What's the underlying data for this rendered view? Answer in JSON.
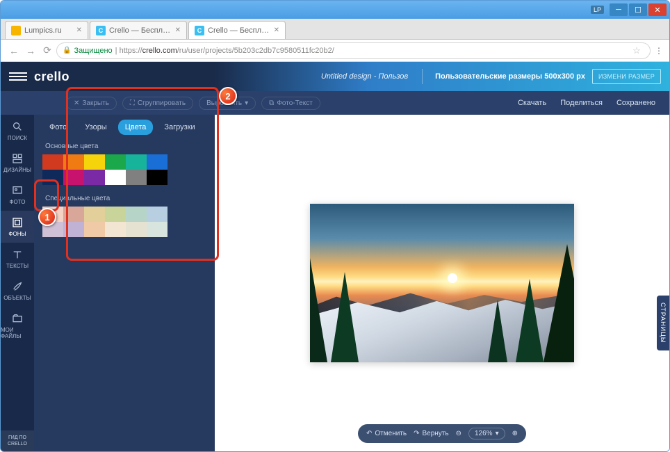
{
  "window": {
    "profile": "LP"
  },
  "tabs": [
    {
      "title": "Lumpics.ru"
    },
    {
      "title": "Crello — Бесплатный ин"
    },
    {
      "title": "Crello — Бесплатный ин"
    }
  ],
  "address": {
    "secure": "Защищено",
    "scheme": "https://",
    "host": "crello.com",
    "path": "/ru/user/projects/5b203c2db7c9580511fc20b2/"
  },
  "header": {
    "logo": "crello",
    "design_title": "Untitled design - Пользов",
    "dimensions": "Пользовательские размеры 500x300 px",
    "resize_btn": "ИЗМЕНИ РАЗМЕР"
  },
  "toolbar": {
    "close": "Закрыть",
    "group": "Сгруппировать",
    "align": "Выровнять",
    "phototext": "Фото-Текст",
    "download": "Скачать",
    "share": "Поделиться",
    "saved": "Сохранено"
  },
  "nav": [
    "ПОИСК",
    "ДИЗАЙНЫ",
    "ФОТО",
    "ФОНЫ",
    "ТЕКСТЫ",
    "ОБЪЕКТЫ",
    "МОИ ФАЙЛЫ"
  ],
  "nav_guide": "ГИД ПО CRELLO",
  "panel": {
    "tabs": [
      "Фото",
      "Узоры",
      "Цвета",
      "Загрузки"
    ],
    "main_colors_label": "Основные цвета",
    "special_colors_label": "Специальные цвета",
    "main_colors": [
      "#d13a1f",
      "#f07b13",
      "#f5d40c",
      "#1aa84a",
      "#18b39b",
      "#1a6fd6",
      "#0f2a5a",
      "#c7126e",
      "#7b2aa6",
      "#ffffff",
      "#808080",
      "#000000"
    ],
    "special_colors": [
      "#f4d2c4",
      "#d8a79a",
      "#e3cf9a",
      "#c9d49a",
      "#b7d4c9",
      "#b7cfe0",
      "#d0c0d6",
      "#bfb2d4",
      "#f0c9a6",
      "#f2e6d2",
      "#e6e2d2",
      "#d8e4de"
    ]
  },
  "side_tab": "СТРАНИЦЫ",
  "bottombar": {
    "undo": "Отменить",
    "redo": "Вернуть",
    "zoom": "126%"
  },
  "markers": [
    "1",
    "2"
  ]
}
